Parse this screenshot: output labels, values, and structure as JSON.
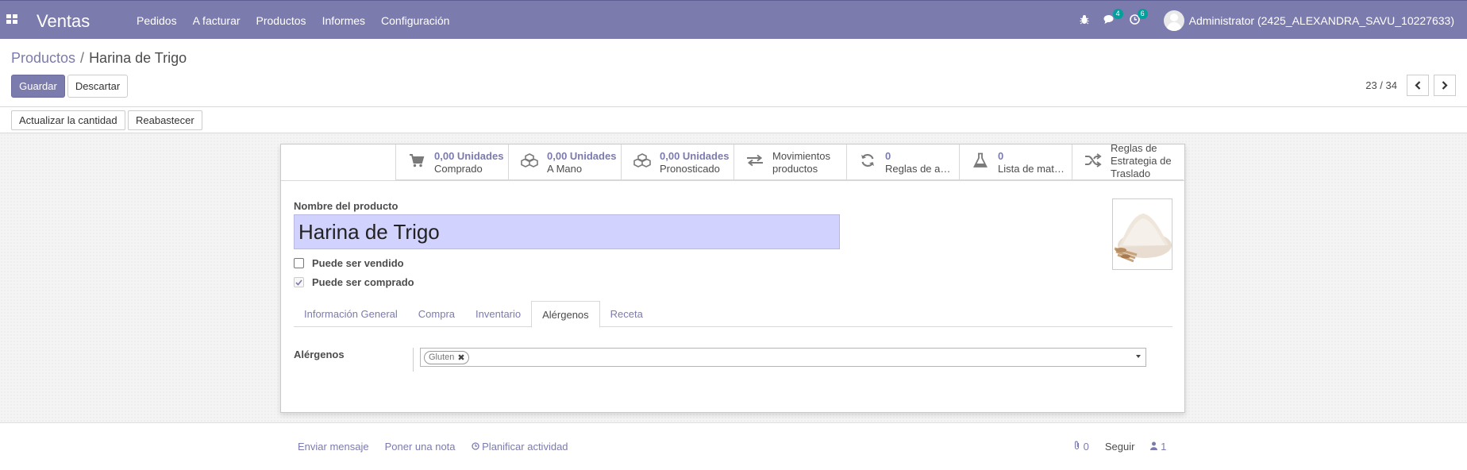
{
  "navbar": {
    "brand": "Ventas",
    "menu": [
      "Pedidos",
      "A facturar",
      "Productos",
      "Informes",
      "Configuración"
    ],
    "messages_count": "4",
    "activities_count": "6",
    "user": "Administrator (2425_ALEXANDRA_SAVU_10227633)",
    "color": "#7c7bad"
  },
  "breadcrumb": {
    "parent": "Productos",
    "separator": "/",
    "current": "Harina de Trigo"
  },
  "actions": {
    "save": "Guardar",
    "discard": "Descartar"
  },
  "pager": {
    "value": "23 / 34"
  },
  "statusbar": {
    "update_qty": "Actualizar la cantidad",
    "replenish": "Reabastecer"
  },
  "smart_buttons": [
    {
      "icon": "shopping-cart-icon",
      "value": "0,00 Unidades",
      "label": "Comprado"
    },
    {
      "icon": "cubes-icon",
      "value": "0,00 Unidades",
      "label": "A Mano"
    },
    {
      "icon": "cubes-icon",
      "value": "0,00 Unidades",
      "label": "Pronosticado"
    },
    {
      "icon": "exchange-icon",
      "value": "Movimientos",
      "label": "productos"
    },
    {
      "icon": "refresh-icon",
      "value": "0",
      "label": "Reglas de a…"
    },
    {
      "icon": "flask-icon",
      "value": "0",
      "label": "Lista de mat…"
    },
    {
      "icon": "random-icon",
      "line1": "Reglas de",
      "line2": "Estrategia de",
      "line3": "Traslado"
    }
  ],
  "form": {
    "name_label": "Nombre del producto",
    "name_value": "Harina de Trigo",
    "can_be_sold": "Puede ser vendido",
    "can_be_purchased": "Puede ser comprado",
    "tabs": [
      "Información General",
      "Compra",
      "Inventario",
      "Alérgenos",
      "Receta"
    ],
    "active_tab": "Alérgenos",
    "allergens_label": "Alérgenos",
    "allergen_tags": [
      "Gluten"
    ]
  },
  "chatter": {
    "send_message": "Enviar mensaje",
    "log_note": "Poner una nota",
    "schedule_activity": "Planificar actividad",
    "attachments": "0",
    "follow": "Seguir",
    "followers": "1"
  }
}
